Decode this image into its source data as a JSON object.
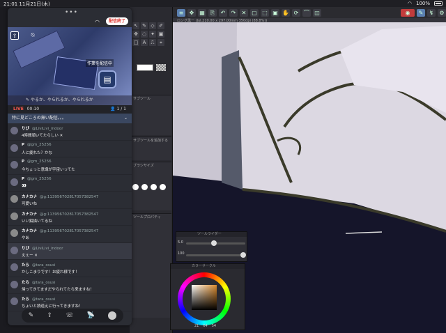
{
  "status_bar": {
    "time": "21:01",
    "date": "11月21日(木)",
    "battery": "100%"
  },
  "app": {
    "tab_title": "ロング黒ー (Jul.210.00 x 297.00mm 350dpi (88.8%))",
    "palette_labels": [
      "サブツール",
      "ブラシサイズ",
      "サブツールを追加する",
      "ツールプロパティ",
      "ブラシサイズ"
    ],
    "slider_panel_title": "ツールライダー",
    "slider_values": [
      "5.0",
      "100"
    ],
    "color_panel_title": "カラーサークル",
    "color_values": [
      "21",
      "64",
      "54"
    ]
  },
  "overlay": {
    "end_button": "配信終了",
    "preview_banner": "作業を配信中",
    "prompt": "やるか、やられるか、やられるか",
    "live_label": "LIVE",
    "live_time": "00:10",
    "viewers": "1 / 1",
    "topic": "特に見どころの無い配信。。。",
    "comments": [
      {
        "name": "りび",
        "handle": "@LiviLivi_indoor",
        "text": "4時間頑いてたらしい ✕",
        "pinned": false,
        "avatar": "dark"
      },
      {
        "name": "P",
        "handle": "@gm_25256",
        "text": "人に疲れた？かな",
        "pinned": false,
        "avatar": "dark"
      },
      {
        "name": "P",
        "handle": "@gm_25256",
        "text": "今ちょっと意識が宇宙いってた",
        "pinned": false,
        "avatar": "dark"
      },
      {
        "name": "P",
        "handle": "@gm_25256",
        "text": "👀",
        "pinned": false,
        "avatar": "dark"
      },
      {
        "name": "カナカナ",
        "handle": "@g:11395670281705738254​7",
        "text": "可愛いね",
        "pinned": false,
        "avatar": "grey"
      },
      {
        "name": "カナカナ",
        "handle": "@g:11395670281705738254​7",
        "text": "いい鉛描いてるね",
        "pinned": false,
        "avatar": "grey"
      },
      {
        "name": "カナカナ",
        "handle": "@g:11395670281705738254​7",
        "text": "やあ",
        "pinned": false,
        "avatar": "grey"
      },
      {
        "name": "りび",
        "handle": "@LiviLivi_indoor",
        "text": "えぇー ✕",
        "pinned": true,
        "avatar": "dark"
      },
      {
        "name": "たら",
        "handle": "@tara_osusi",
        "text": "かしこまりです！お疲れ様です！",
        "pinned": false,
        "avatar": "dark"
      },
      {
        "name": "たら",
        "handle": "@tara_osusi",
        "text": "帰ってきてますだやられてたら来ますね！",
        "pinned": false,
        "avatar": "dark"
      },
      {
        "name": "たら",
        "handle": "@tara_osusi",
        "text": "ちょいと読道えに行ってきますね！",
        "pinned": false,
        "avatar": "dark"
      }
    ],
    "bottom_icons": [
      "edit-icon",
      "share-icon",
      "chat-icon",
      "broadcast-icon",
      "avatar"
    ]
  }
}
